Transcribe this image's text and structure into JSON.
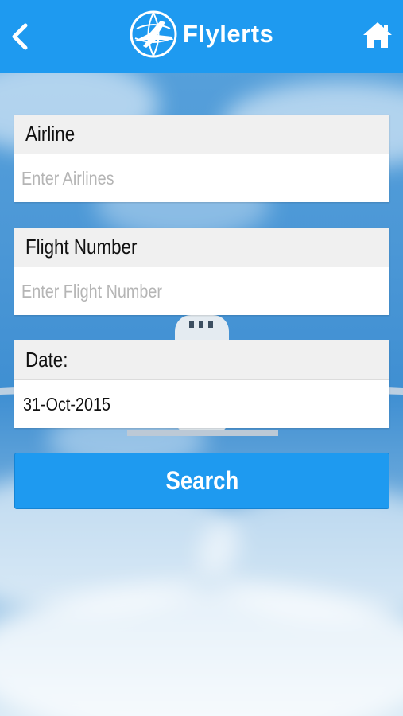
{
  "header": {
    "brand_name": "Flylerts",
    "back_icon": "chevron-left-icon",
    "home_icon": "home-icon",
    "background_color": "#1e9af0"
  },
  "form": {
    "airline": {
      "label": "Airline",
      "placeholder": "Enter Airlines",
      "value": ""
    },
    "flight_number": {
      "label": "Flight Number",
      "placeholder": "Enter Flight Number",
      "value": ""
    },
    "date": {
      "label": "Date:",
      "value": "31-Oct-2015"
    },
    "search_label": "Search"
  }
}
